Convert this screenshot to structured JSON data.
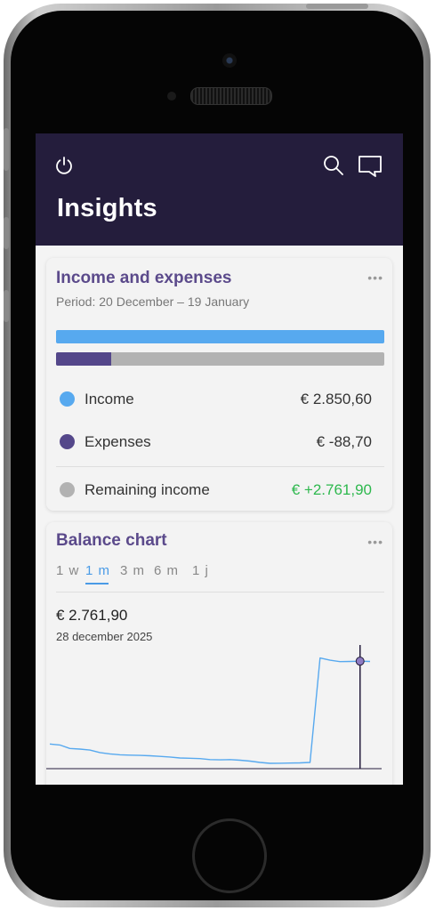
{
  "header": {
    "title": "Insights",
    "icons": [
      "power-icon",
      "search-icon",
      "chat-icon"
    ]
  },
  "income_expenses": {
    "title": "Income and expenses",
    "more": "•••",
    "period": "Period: 20 December – 19 January",
    "expense_share_of_income": 0.167,
    "rows": [
      {
        "label": "Income",
        "value": "€ 2.850,60",
        "color": "#57a9ef"
      },
      {
        "label": "Expenses",
        "value": "€ -88,70",
        "color": "#54478a"
      },
      {
        "label": "Remaining income",
        "value": "€ +2.761,90",
        "color": "#b2b2b2",
        "value_color": "#2eb84e"
      }
    ]
  },
  "balance": {
    "title": "Balance chart",
    "more": "•••",
    "tabs": [
      "1 w",
      "1 m",
      "3 m",
      "6 m",
      "1 j"
    ],
    "active_tab": "1 m",
    "value": "€ 2.761,90",
    "date": "28 december 2025"
  },
  "chart_data": {
    "type": "line",
    "title": "",
    "xlabel": "",
    "ylabel": "",
    "x_range": [
      "20 December",
      "19 January"
    ],
    "values": [
      1475,
      1460,
      1405,
      1395,
      1380,
      1340,
      1320,
      1305,
      1300,
      1295,
      1290,
      1280,
      1270,
      1255,
      1250,
      1245,
      1230,
      1225,
      1230,
      1220,
      1205,
      1185,
      1170,
      1172,
      1175,
      1178,
      1185,
      2835,
      2800,
      2778,
      2780,
      2785,
      2780
    ],
    "highlight_index": 31,
    "ylim": [
      1100,
      2900
    ],
    "grid": false,
    "line_color": "#57a9ef",
    "marker_color": "#8e7cc3",
    "cursor_color": "#241d3c"
  }
}
